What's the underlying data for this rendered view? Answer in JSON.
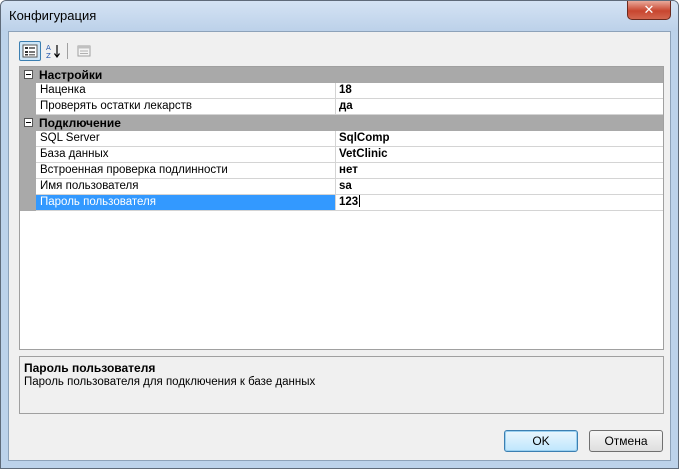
{
  "window": {
    "title": "Конфигурация",
    "close_glyph": "✕"
  },
  "toolbar": {
    "categorized_icon": "categorized-view-icon",
    "alphabetical_icon": "alphabetical-sort-icon",
    "property_pages_icon": "property-pages-icon"
  },
  "grid": {
    "categories": [
      {
        "label": "Настройки",
        "properties": [
          {
            "name": "Наценка",
            "value": "18"
          },
          {
            "name": "Проверять остатки лекарств",
            "value": "да"
          }
        ]
      },
      {
        "label": "Подключение",
        "properties": [
          {
            "name": "SQL Server",
            "value": "SqlComp"
          },
          {
            "name": "База данных",
            "value": "VetClinic"
          },
          {
            "name": "Встроенная проверка подлинности",
            "value": "нет"
          },
          {
            "name": "Имя пользователя",
            "value": "sa"
          },
          {
            "name": "Пароль пользователя",
            "value": "123"
          }
        ]
      }
    ],
    "selected_property": "Пароль пользователя"
  },
  "description": {
    "title": "Пароль пользователя",
    "text": "Пароль пользователя для подключения к базе данных"
  },
  "buttons": {
    "ok": "OK",
    "cancel": "Отмена"
  },
  "colors": {
    "selection": "#3399ff",
    "category_band": "#a9a9a9"
  }
}
